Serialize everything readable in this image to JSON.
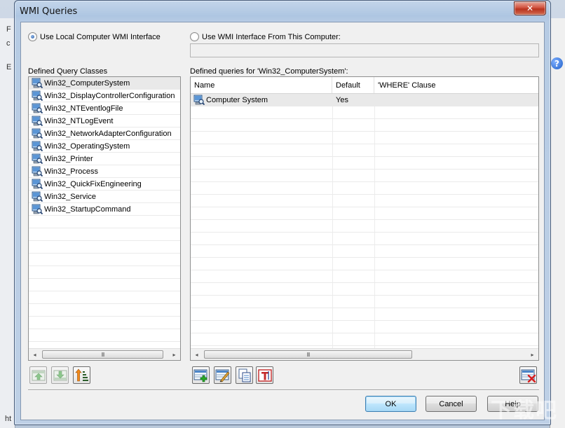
{
  "window": {
    "title": "WMI Queries",
    "close_glyph": "✕"
  },
  "interface": {
    "local_label": "Use Local Computer WMI Interface",
    "local_selected": true,
    "remote_label": "Use WMI Interface From This Computer:",
    "remote_selected": false,
    "remote_value": ""
  },
  "classes": {
    "label": "Defined Query Classes",
    "items": [
      "Win32_ComputerSystem",
      "Win32_DisplayControllerConfiguration",
      "Win32_NTEventlogFile",
      "Win32_NTLogEvent",
      "Win32_NetworkAdapterConfiguration",
      "Win32_OperatingSystem",
      "Win32_Printer",
      "Win32_Process",
      "Win32_QuickFixEngineering",
      "Win32_Service",
      "Win32_StartupCommand"
    ],
    "selected_index": 0
  },
  "queries": {
    "label": "Defined queries for 'Win32_ComputerSystem':",
    "columns": [
      "Name",
      "Default",
      "'WHERE' Clause"
    ],
    "rows": [
      {
        "name": "Computer System",
        "default": "Yes",
        "where": ""
      }
    ]
  },
  "scrollbar": {
    "left_arrow": "◂",
    "right_arrow": "▸",
    "grip": "III"
  },
  "buttons": {
    "ok": "OK",
    "cancel": "Cancel",
    "help": "Help"
  },
  "background": {
    "left_letters": [
      "F",
      "c",
      "E"
    ],
    "bottom_left": "ht",
    "help_glyph": "?"
  },
  "watermark": "下载吧",
  "colors": {
    "selection": "#e9e9e9",
    "default_button": "#3c7fb1",
    "close_button": "#c7432b"
  },
  "icons": {
    "class_item": "computer-search-icon",
    "move_up": "move-up-icon",
    "move_down": "move-down-icon",
    "sort": "sort-icon",
    "add_query": "add-query-icon",
    "edit_query": "edit-query-icon",
    "copy_query": "copy-query-icon",
    "rename_query": "rename-query-icon",
    "delete_query": "delete-query-icon"
  }
}
